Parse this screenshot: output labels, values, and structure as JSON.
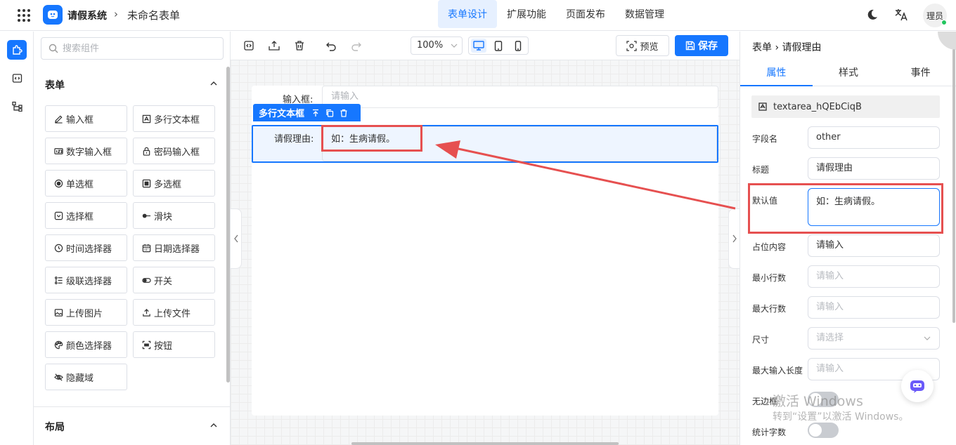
{
  "header": {
    "app_name": "请假系统",
    "crumb_sep": "›",
    "form_name": "未命名表单",
    "tabs": [
      {
        "label": "表单设计"
      },
      {
        "label": "扩展功能"
      },
      {
        "label": "页面发布"
      },
      {
        "label": "数据管理"
      }
    ],
    "avatar_text": "理员"
  },
  "components": {
    "search_placeholder": "搜索组件",
    "section_form": "表单",
    "section_layout": "布局",
    "items": [
      {
        "label": "输入框",
        "icon": "edit-icon"
      },
      {
        "label": "多行文本框",
        "icon": "textarea-icon"
      },
      {
        "label": "数字输入框",
        "icon": "number-icon"
      },
      {
        "label": "密码输入框",
        "icon": "lock-icon"
      },
      {
        "label": "单选框",
        "icon": "radio-icon"
      },
      {
        "label": "多选框",
        "icon": "checkbox-icon"
      },
      {
        "label": "选择框",
        "icon": "select-icon"
      },
      {
        "label": "滑块",
        "icon": "slider-icon"
      },
      {
        "label": "时间选择器",
        "icon": "clock-icon"
      },
      {
        "label": "日期选择器",
        "icon": "calendar-icon"
      },
      {
        "label": "级联选择器",
        "icon": "cascader-icon"
      },
      {
        "label": "开关",
        "icon": "switch-icon"
      },
      {
        "label": "上传图片",
        "icon": "image-icon"
      },
      {
        "label": "上传文件",
        "icon": "upload-icon"
      },
      {
        "label": "颜色选择器",
        "icon": "palette-icon"
      },
      {
        "label": "按钮",
        "icon": "button-icon"
      },
      {
        "label": "隐藏域",
        "icon": "eye-off-icon"
      }
    ]
  },
  "toolbar": {
    "zoom": "100%",
    "preview": "预览",
    "save": "保存"
  },
  "canvas": {
    "row1_label": "输入框:",
    "row1_placeholder": "请输入",
    "selected_tag": "多行文本框",
    "selected_label": "请假理由:",
    "selected_value": "如：生病请假。"
  },
  "props": {
    "crumb": "表单 › 请假理由",
    "tabs": [
      "属性",
      "样式",
      "事件"
    ],
    "component_id": "textarea_hQEbCiqB",
    "fields": {
      "field_name_label": "字段名",
      "field_name_value": "other",
      "title_label": "标题",
      "title_value": "请假理由",
      "default_label": "默认值",
      "default_value": "如：生病请假。",
      "placeholder_label": "占位内容",
      "placeholder_value": "请输入",
      "min_rows_label": "最小行数",
      "min_rows_ph": "请输入",
      "max_rows_label": "最大行数",
      "max_rows_ph": "请输入",
      "size_label": "尺寸",
      "size_ph": "请选择",
      "max_len_label": "最大输入长度",
      "max_len_ph": "请输入",
      "borderless_label": "无边框",
      "word_count_label": "统计字数"
    }
  },
  "watermark": {
    "line1": "激活 Windows",
    "line2": "转到“设置”以激活 Windows。"
  },
  "colors": {
    "accent": "#1677ff",
    "annotation": "#e65050"
  }
}
